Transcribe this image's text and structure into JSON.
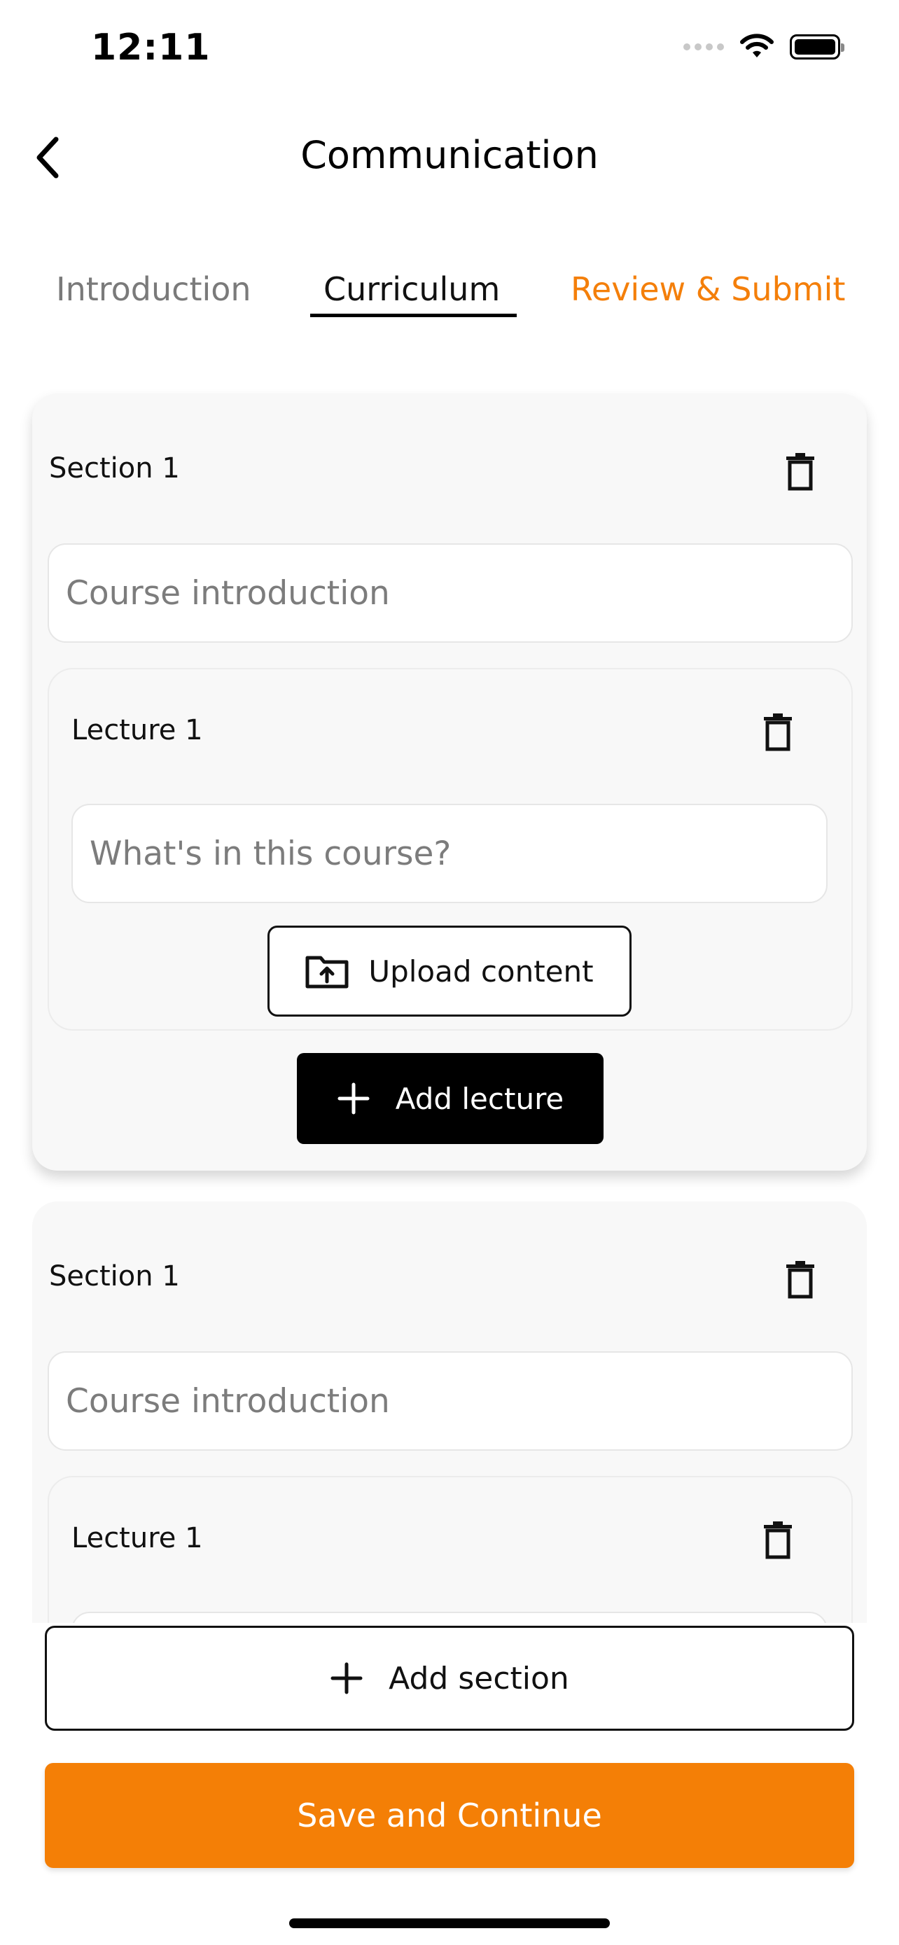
{
  "status_bar": {
    "time": "12:11",
    "icons": [
      "signal-dots-icon",
      "wifi-icon",
      "battery-icon"
    ]
  },
  "header": {
    "back_icon": "chevron-left-icon",
    "title": "Communication"
  },
  "tabs": [
    {
      "label": "Introduction",
      "state": "inactive",
      "color": "#7a7a7a"
    },
    {
      "label": "Curriculum",
      "state": "active",
      "color": "#111111"
    },
    {
      "label": "Review & Submit",
      "state": "inactive",
      "color": "#f47f0a"
    }
  ],
  "sections": [
    {
      "title": "Section 1",
      "delete_icon": "trash-icon",
      "title_placeholder": "Course introduction",
      "lectures": [
        {
          "title": "Lecture 1",
          "delete_icon": "trash-icon",
          "content_placeholder": "What's in this course?",
          "upload_label": "Upload content",
          "upload_icon": "folder-upload-icon"
        }
      ],
      "add_lecture_label": "Add lecture",
      "add_icon": "plus-icon"
    },
    {
      "title": "Section 1",
      "delete_icon": "trash-icon",
      "title_placeholder": "Course introduction",
      "lectures": [
        {
          "title": "Lecture 1",
          "delete_icon": "trash-icon"
        }
      ]
    }
  ],
  "actions": {
    "add_section_label": "Add section",
    "add_section_icon": "plus-icon",
    "save_label": "Save and Continue"
  },
  "colors": {
    "accent": "#f47f06",
    "primary_dark": "#000000",
    "card_bg": "#f8f8f8"
  }
}
